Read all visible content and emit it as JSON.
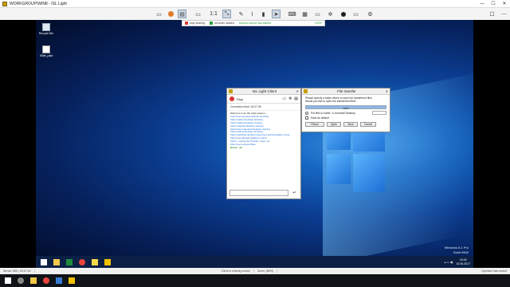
{
  "window": {
    "title": "WORKGROUP\\WIN8 - ISL Light",
    "controls": {
      "minimize": "—",
      "maximize": "☐",
      "close": "✕"
    }
  },
  "toolbar": {
    "zoom_label": "1:1",
    "tools": [
      "monitor-icon",
      "chat-icon",
      "pen-icon",
      "brush-icon",
      "eraser-icon",
      "marker-icon",
      "pointer-icon",
      "keyboard-icon",
      "grid-icon",
      "tools-icon",
      "display-icon",
      "record-icon",
      "settings-icon"
    ]
  },
  "notification": {
    "stop_sharing": "stop sharing",
    "recorder_started": "recorder started",
    "session_saved": "session saved has started",
    "percent": "100%"
  },
  "desktop": {
    "icons": [
      {
        "label": "Recycle Bin",
        "name": "recycle-bin-icon"
      },
      {
        "label": "ISlite_pakt",
        "name": "file-icon"
      }
    ],
    "watermark": {
      "line1": "Windows 8.1 Pro",
      "line2": "Build 9600",
      "line3": "",
      "line4": ""
    },
    "taskbar": {
      "items": [
        "start-icon",
        "explorer-icon",
        "excel-icon",
        "chrome-icon",
        "notes-icon",
        "isl-icon"
      ],
      "clock_time": "15:44",
      "clock_date": "16.05.2017",
      "colors": {
        "start": "#ffffff",
        "explorer": "#f2c84b",
        "excel": "#1f8a3b",
        "chrome": "#e8453c",
        "notes": "#f2d84b",
        "isl": "#f2c200"
      }
    }
  },
  "isl_client": {
    "title": "ISL Light Client",
    "stop_label": "Stop",
    "connection_time": "Connection time: 00:07:35",
    "log": [
      {
        "text": "Welcome to an ISL Light session.",
        "style": "plain"
      },
      {
        "text": "Client has stopped desktop showing",
        "style": "ts"
      },
      {
        "text": "Client started desktop showing",
        "style": "ts"
      },
      {
        "text": "Client started desktop viewing",
        "style": "ts"
      },
      {
        "text": "Client stopped desktop viewing",
        "style": "ts"
      },
      {
        "text": "Client has requested desktop viewing",
        "style": "ts"
      },
      {
        "text": "Client started desktop showing",
        "style": "ts"
      },
      {
        "text": "Client switched desktop showing to administrative mode",
        "style": "ts"
      },
      {
        "text": "Client has allowed desktop control",
        "style": "ts"
      },
      {
        "text": "Client - seeing the Transfer maze out",
        "style": "ts"
      },
      {
        "text": "Client has received files",
        "style": "ts"
      },
      {
        "text": "Good. - ok",
        "style": "ok"
      }
    ],
    "send_icon": "↵"
  },
  "file_transfer": {
    "title": "File transfer",
    "message_line1": "Please specify a folder where to save the transferred files",
    "message_line2": "Would you like to open the transferred files?",
    "progress_percent": 100,
    "progress_label": "100%",
    "folder_option": "Put files in folder: ⊙ Users\\all Desktop",
    "save_default": "Save as default",
    "buttons": {
      "pause": "Pause",
      "open": "Open",
      "save": "Save",
      "cancel": "Cancel"
    }
  },
  "statusbar": {
    "server": "Server: 800 | 00:07:40",
    "sharing": "Client is sharing screen",
    "zoom": "Zoom: (86%)",
    "right": "Operator has control"
  }
}
